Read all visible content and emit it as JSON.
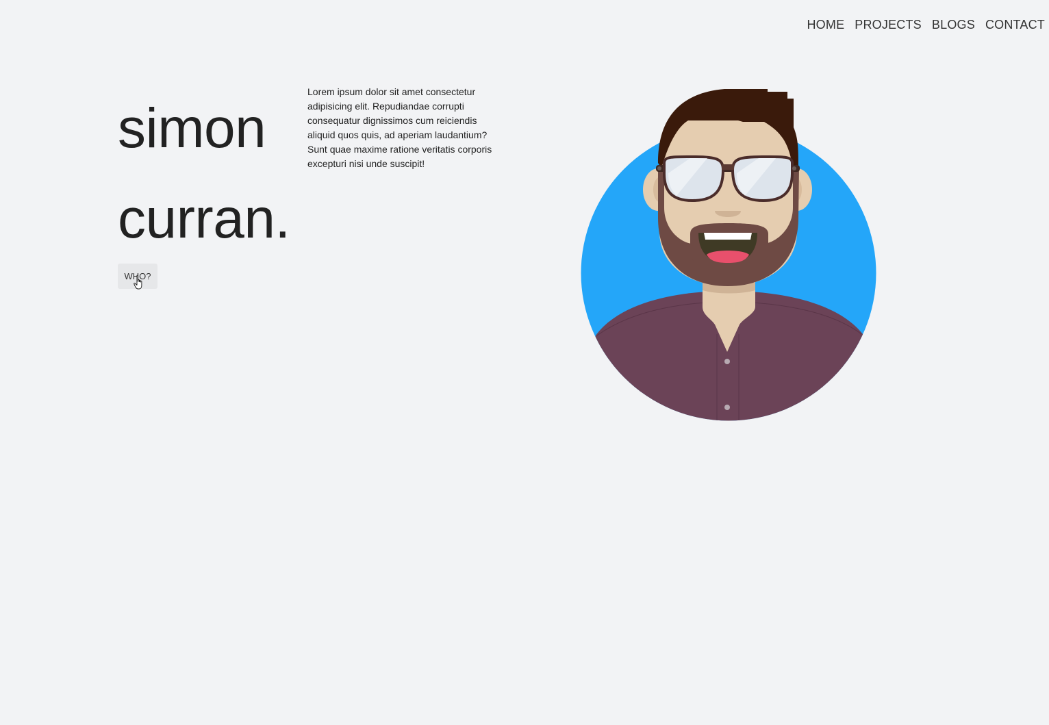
{
  "nav": {
    "items": [
      "HOME",
      "PROJECTS",
      "BLOGS",
      "CONTACT"
    ]
  },
  "hero": {
    "first_name": "simon",
    "last_name": "curran.",
    "bio": "Lorem ipsum dolor sit amet consectetur adipisicing elit. Repudiandae corrupti consequatur dignissimos cum reiciendis aliquid quos quis, ad aperiam laudantium? Sunt quae maxime ratione veritatis corporis excepturi nisi unde suscipit!",
    "who_button": "WHO?"
  },
  "colors": {
    "background": "#f2f3f5",
    "avatar_circle": "#24a6f9",
    "shirt": "#6b4357",
    "hair": "#3a1a0b",
    "beard": "#6e4a44",
    "skin": "#e5cdb0"
  },
  "icons": {
    "cursor": "hand-pointer-icon",
    "avatar": "man-with-glasses-avatar"
  }
}
